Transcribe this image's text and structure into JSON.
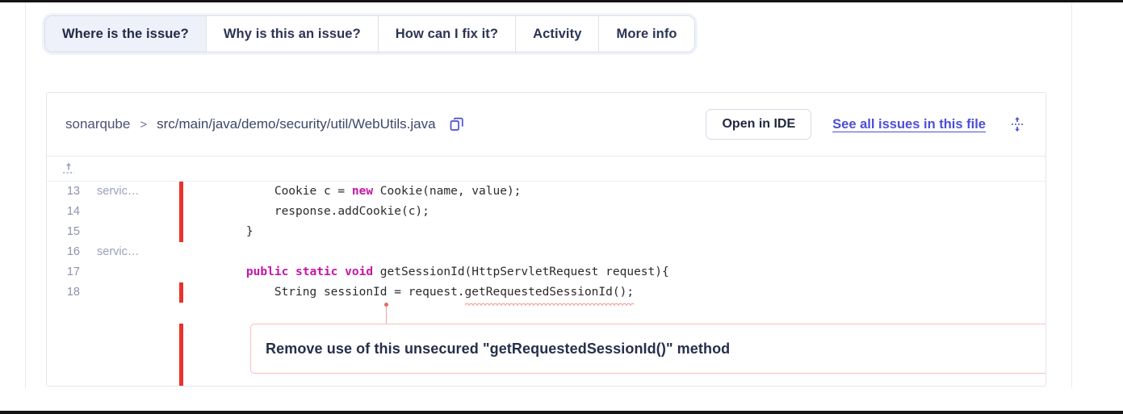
{
  "tabs": [
    {
      "label": "Where is the issue?",
      "active": true
    },
    {
      "label": "Why is this an issue?",
      "active": false
    },
    {
      "label": "How can I fix it?",
      "active": false
    },
    {
      "label": "Activity",
      "active": false
    },
    {
      "label": "More info",
      "active": false
    }
  ],
  "breadcrumb": {
    "project": "sonarqube",
    "separator": ">",
    "file_path": "src/main/java/demo/security/util/WebUtils.java",
    "copy_icon": "copy-icon"
  },
  "actions": {
    "open_in_ide_label": "Open in IDE",
    "see_all_issues_label": "See all issues in this file",
    "expand_icon": "expand-vertical-icon",
    "expand_up_icon": "expand-up-icon"
  },
  "code": {
    "lines": [
      {
        "number": "13",
        "scm": "servic…",
        "bar": "red",
        "segments": [
          {
            "t": "        Cookie c = ",
            "k": false
          },
          {
            "t": "new",
            "k": true
          },
          {
            "t": " Cookie(name, value);",
            "k": false
          }
        ]
      },
      {
        "number": "14",
        "scm": "",
        "bar": "red",
        "segments": [
          {
            "t": "        response.addCookie(c);",
            "k": false
          }
        ]
      },
      {
        "number": "15",
        "scm": "",
        "bar": "red",
        "segments": [
          {
            "t": "    }",
            "k": false
          }
        ]
      },
      {
        "number": "16",
        "scm": "servic…",
        "bar": "blank",
        "segments": [
          {
            "t": "",
            "k": false
          }
        ]
      },
      {
        "number": "17",
        "scm": "",
        "bar": "blank",
        "segments": [
          {
            "t": "    ",
            "k": false
          },
          {
            "t": "public static void",
            "k": true
          },
          {
            "t": " getSessionId(HttpServletRequest request){",
            "k": false
          }
        ]
      },
      {
        "number": "18",
        "scm": "",
        "bar": "red",
        "segments": [
          {
            "t": "        String sessionId = request.",
            "k": false
          }
        ]
      }
    ],
    "underlined_token": "getRequestedSessionId();"
  },
  "issue": {
    "message": "Remove use of this unsecured \"getRequestedSessionId()\" method"
  },
  "colors": {
    "coverage_red": "#e8342a",
    "issue_border": "#f6c0b9",
    "link": "#4b4fd6",
    "keyword": "#c316a8",
    "active_tab_bg": "#eef0fa"
  }
}
